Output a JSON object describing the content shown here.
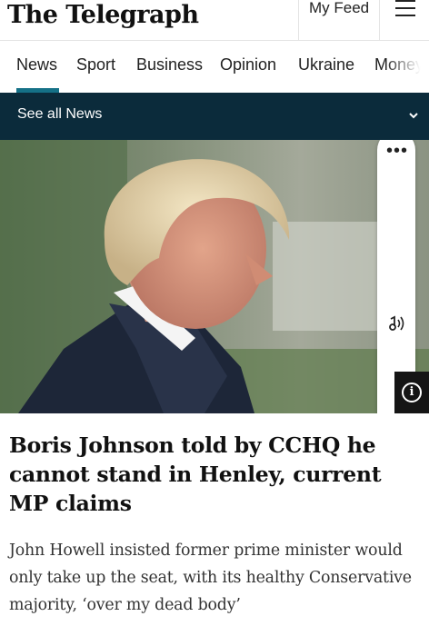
{
  "header": {
    "logo": "The Telegraph",
    "my_feed_label": "My Feed",
    "menu_icon": "hamburger-menu-icon"
  },
  "nav": {
    "tabs": [
      {
        "label": "News",
        "active": true
      },
      {
        "label": "Sport",
        "active": false
      },
      {
        "label": "Business",
        "active": false
      },
      {
        "label": "Opinion",
        "active": false
      },
      {
        "label": "Ukraine",
        "active": false
      },
      {
        "label": "Money",
        "active": false
      }
    ],
    "accent_color": "#157187"
  },
  "section_bar": {
    "label": "See all News",
    "icon": "chevron-down-icon",
    "background": "#0b2b3b"
  },
  "hero": {
    "toolbar_icons": [
      "more-dots-icon",
      "listen-audio-icon"
    ],
    "info_icon": "info-icon"
  },
  "article": {
    "headline": "Boris Johnson told by CCHQ he cannot stand in Henley, current MP claims",
    "standfirst": "John Howell insisted former prime minister would only take up the seat, with its healthy Conservative majority, ‘over my dead body’"
  }
}
